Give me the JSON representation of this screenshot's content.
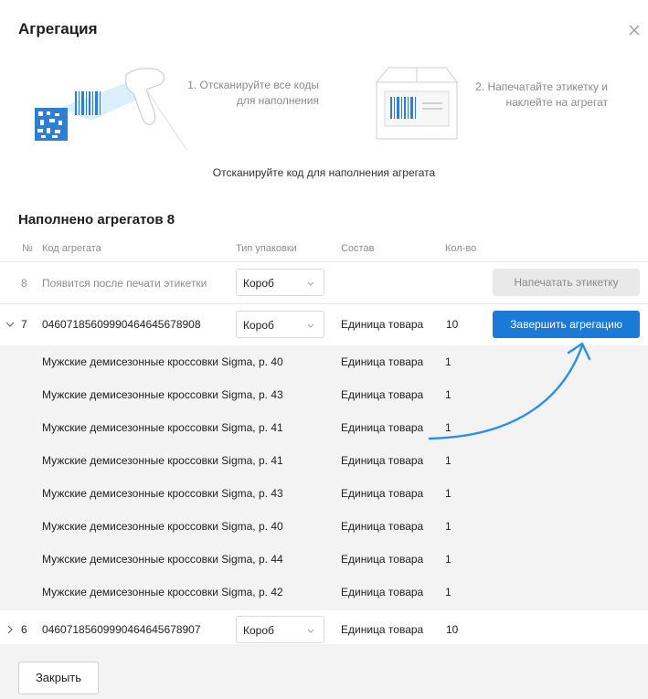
{
  "dialog": {
    "title": "Агрегация",
    "close_label": "Закрыть"
  },
  "steps": {
    "step1": "1. Отсканируйте все коды для наполнения",
    "step2": "2. Напечатайте этикетку и наклейте на агрегат"
  },
  "scan_hint": "Отсканируйте код для наполнения агрегата",
  "section_title": "Наполнено агрегатов 8",
  "table": {
    "headers": {
      "no": "№",
      "code": "Код агрегата",
      "pack": "Тип упаковки",
      "composition": "Состав",
      "qty": "Кол-во"
    },
    "pending_row": {
      "no": "8",
      "code": "Появится после печати этикетки",
      "pack": "Короб",
      "action": "Напечатать этикетку"
    },
    "row7": {
      "no": "7",
      "code": "04607185609990464645678908",
      "pack": "Короб",
      "composition": "Единица товара",
      "qty": "10",
      "action": "Завершить агрегацию",
      "items": [
        {
          "name": "Мужские демисезонные кроссовки Sigma, р. 40",
          "composition": "Единица товара",
          "qty": "1"
        },
        {
          "name": "Мужские демисезонные кроссовки Sigma, р. 43",
          "composition": "Единица товара",
          "qty": "1"
        },
        {
          "name": "Мужские демисезонные кроссовки Sigma, р. 41",
          "composition": "Единица товара",
          "qty": "1"
        },
        {
          "name": "Мужские демисезонные кроссовки Sigma, р. 41",
          "composition": "Единица товара",
          "qty": "1"
        },
        {
          "name": "Мужские демисезонные кроссовки Sigma, р. 43",
          "composition": "Единица товара",
          "qty": "1"
        },
        {
          "name": "Мужские демисезонные кроссовки Sigma, р. 40",
          "composition": "Единица товара",
          "qty": "1"
        },
        {
          "name": "Мужские демисезонные кроссовки Sigma, р. 44",
          "composition": "Единица товара",
          "qty": "1"
        },
        {
          "name": "Мужские демисезонные кроссовки Sigma, р. 42",
          "composition": "Единица товара",
          "qty": "1"
        }
      ]
    },
    "row6": {
      "no": "6",
      "code": "04607185609990464645678907",
      "pack": "Короб",
      "composition": "Единица товара",
      "qty": "10"
    }
  },
  "colors": {
    "accent": "#1b7ad8",
    "arrow": "#2a8ef0",
    "expanded_bg": "#f3f3f3"
  }
}
